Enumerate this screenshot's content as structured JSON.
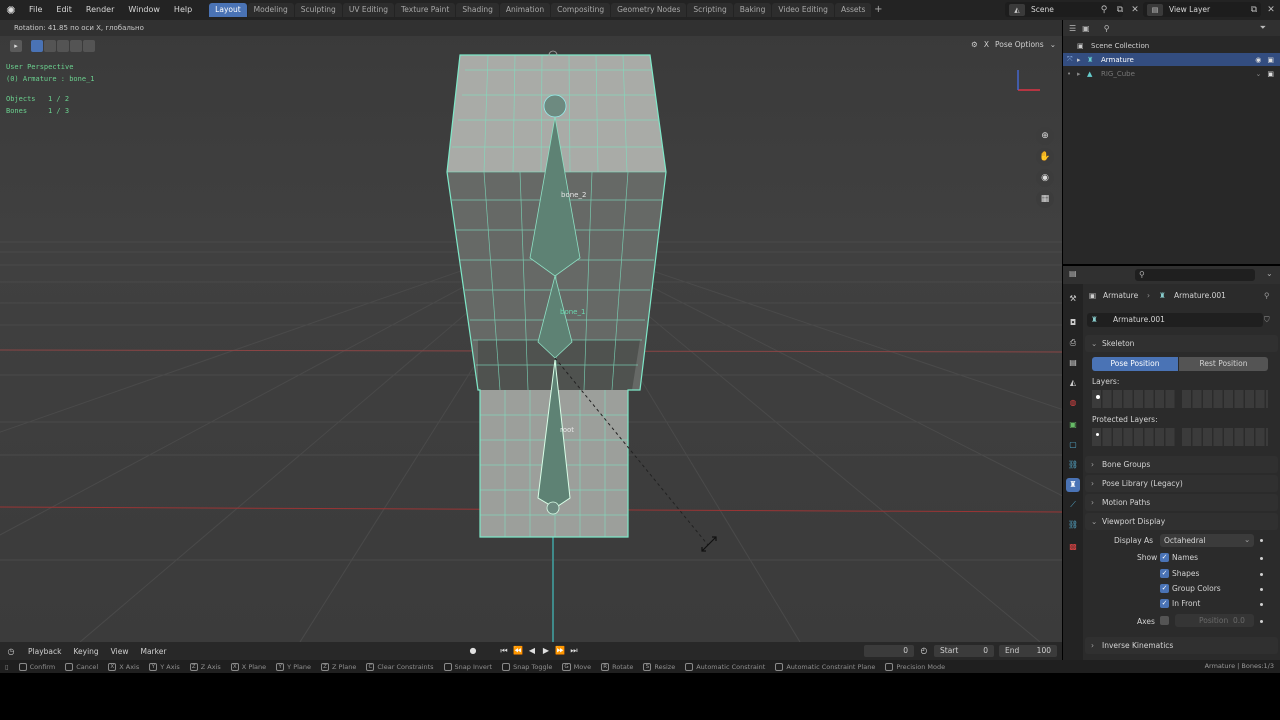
{
  "topbar": {
    "menu": [
      "File",
      "Edit",
      "Render",
      "Window",
      "Help"
    ],
    "workspaces": [
      "Layout",
      "Modeling",
      "Sculpting",
      "UV Editing",
      "Texture Paint",
      "Shading",
      "Animation",
      "Compositing",
      "Geometry Nodes",
      "Scripting",
      "Baking",
      "Video Editing",
      "Assets"
    ],
    "active_workspace": "Layout",
    "scene": "Scene",
    "view_layer": "View Layer"
  },
  "viewport": {
    "header_status": "Rotation: 41.85 по оси X, глобально",
    "perspective": "User Perspective",
    "context": "(0) Armature : bone_1",
    "objects_label": "Objects",
    "objects_value": "1 / 2",
    "bones_label": "Bones",
    "bones_value": "1 / 3",
    "pose_options": "Pose Options",
    "bone_labels": [
      "bone_2",
      "bone_1",
      "root"
    ]
  },
  "timeline": {
    "menus": [
      "Playback",
      "Keying",
      "View",
      "Marker"
    ],
    "current_frame": "0",
    "start_label": "Start",
    "start_value": "0",
    "end_label": "End",
    "end_value": "100"
  },
  "statusbar": {
    "items": [
      {
        "key": "",
        "label": "Confirm"
      },
      {
        "key": "",
        "label": "Cancel"
      },
      {
        "key": "X",
        "label": "X Axis"
      },
      {
        "key": "Y",
        "label": "Y Axis"
      },
      {
        "key": "Z",
        "label": "Z Axis"
      },
      {
        "key": "X",
        "label": "X Plane"
      },
      {
        "key": "Y",
        "label": "Y Plane"
      },
      {
        "key": "Z",
        "label": "Z Plane"
      },
      {
        "key": "C",
        "label": "Clear Constraints"
      },
      {
        "key": "",
        "label": "Snap Invert"
      },
      {
        "key": "",
        "label": "Snap Toggle"
      },
      {
        "key": "G",
        "label": "Move"
      },
      {
        "key": "R",
        "label": "Rotate"
      },
      {
        "key": "S",
        "label": "Resize"
      },
      {
        "key": "",
        "label": "Automatic Constraint"
      },
      {
        "key": "",
        "label": "Automatic Constraint Plane"
      },
      {
        "key": "",
        "label": "Precision Mode"
      }
    ],
    "right": "Armature | Bones:1/3"
  },
  "outliner": {
    "collection": "Scene Collection",
    "rows": [
      "Armature",
      "RIG_Cube"
    ]
  },
  "properties": {
    "breadcrumb_object": "Armature",
    "breadcrumb_data": "Armature.001",
    "datablock": "Armature.001",
    "skeleton_label": "Skeleton",
    "pose_position": "Pose Position",
    "rest_position": "Rest Position",
    "layers_label": "Layers:",
    "protected_layers_label": "Protected Layers:",
    "bone_groups": "Bone Groups",
    "pose_library": "Pose Library (Legacy)",
    "motion_paths": "Motion Paths",
    "viewport_display": "Viewport Display",
    "display_as_label": "Display As",
    "display_as_value": "Octahedral",
    "show_label": "Show",
    "show_names": "Names",
    "show_shapes": "Shapes",
    "show_group_colors": "Group Colors",
    "show_in_front": "In Front",
    "axes_label": "Axes",
    "position_label": "Position",
    "position_value": "0.0",
    "inverse_kinematics": "Inverse Kinematics"
  },
  "colors": {
    "accent": "#4a73b5",
    "selection": "#6bd8b0",
    "viewport_bg": "#3d3d3d"
  }
}
